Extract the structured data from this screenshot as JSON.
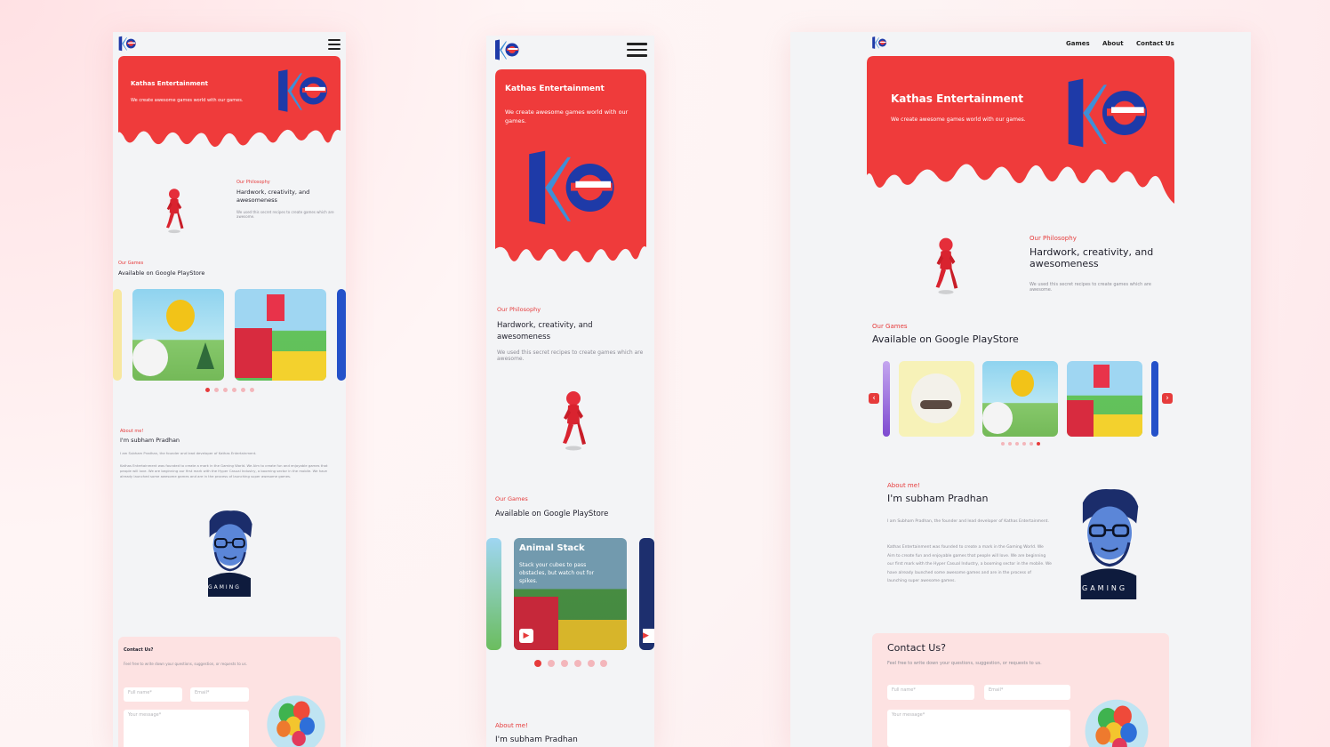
{
  "brand": {
    "name": "Kathas Entertainment",
    "tagline": "We create awesome games world with our games.",
    "logo_text": "ke"
  },
  "nav": {
    "games": "Games",
    "about": "About",
    "contact": "Contact Us"
  },
  "philosophy": {
    "eyebrow": "Our Philosophy",
    "heading": "Hardwork, creativity, and awesomeness",
    "body": "We used this secret recipes to create games which are awesome."
  },
  "games": {
    "eyebrow": "Our Games",
    "heading": "Available on Google PlayStore",
    "featured_title": "Animal Stack",
    "featured_desc": "Stack your cubes to pass obstacles, but watch out for spikes."
  },
  "about": {
    "eyebrow": "About me!",
    "heading": "I'm subham Pradhan",
    "intro": "I am Subham Pradhan, the founder and lead developer of Kathas Entertainment.",
    "body": "Kathas Entertainment was founded to create a mark in the Gaming World. We Aim to create fun and enjoyable games that people will love. We are beginning our first mark with the Hyper Casual Industry, a booming sector in the mobile. We have already launched some awesome games and are in the process of launching super awesome games.",
    "shirt": "GAMING"
  },
  "contact": {
    "heading": "Contact Us?",
    "body": "Feel free to write down your questions, suggestion, or requests to us.",
    "name_placeholder": "Full name*",
    "email_placeholder": "Email*",
    "message_placeholder": "Your message*"
  },
  "colors": {
    "accent": "#ef3b3b",
    "pink_bg": "#fde2e2",
    "screen_bg": "#f3f4f6"
  }
}
